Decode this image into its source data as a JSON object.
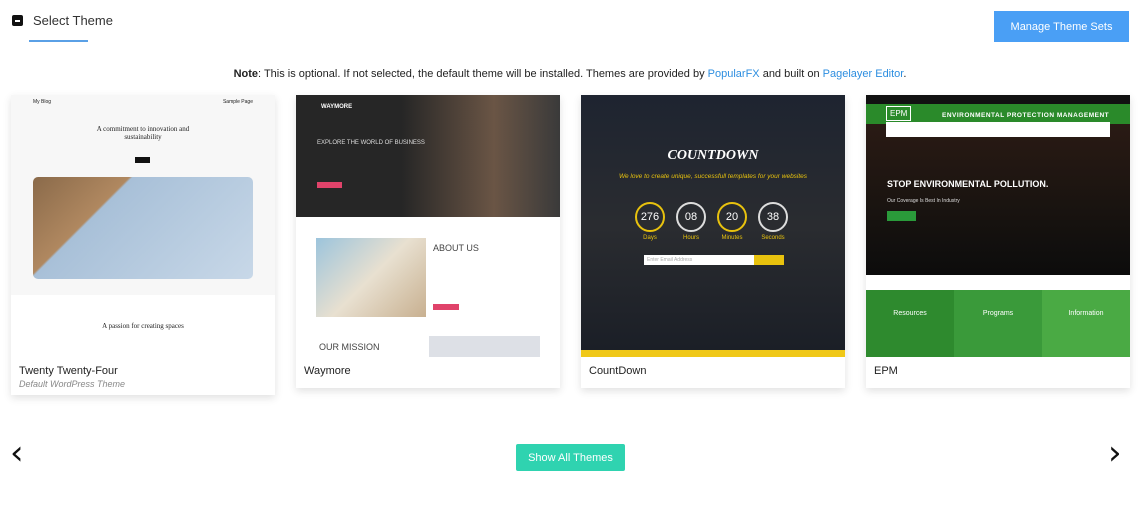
{
  "header": {
    "title": "Select Theme",
    "manage_button": "Manage Theme Sets"
  },
  "note": {
    "bold": "Note",
    "text": ": This is optional. If not selected, the default theme will be installed. Themes are provided by ",
    "link1": "PopularFX",
    "middle": " and built on ",
    "link2": "Pagelayer Editor",
    "end": "."
  },
  "themes": [
    {
      "name": "Twenty Twenty-Four",
      "subtitle": "Default WordPress Theme",
      "preview": {
        "site": "My Blog",
        "nav": "Sample Page",
        "headline": "A commitment to innovation and sustainability",
        "section": "A passion for creating spaces"
      }
    },
    {
      "name": "Waymore",
      "preview": {
        "logo": "WAYMORE",
        "hero": "EXPLORE THE WORLD OF BUSINESS",
        "about": "ABOUT US",
        "mission": "OUR MISSION"
      }
    },
    {
      "name": "CountDown",
      "preview": {
        "title": "COUNTDOWN",
        "tagline": "We love to create unique, successfull templates for your websites",
        "timer": [
          {
            "value": "276",
            "unit": "Days"
          },
          {
            "value": "08",
            "unit": "Hours"
          },
          {
            "value": "20",
            "unit": "Minutes"
          },
          {
            "value": "38",
            "unit": "Seconds"
          }
        ],
        "email_placeholder": "Enter Email Address"
      }
    },
    {
      "name": "EPM",
      "preview": {
        "logo": "EPM",
        "banner": "ENVIRONMENTAL PROTECTION MANAGEMENT",
        "hero": "STOP ENVIRONMENTAL POLLUTION.",
        "hero_sub": "Our Coverage Is Best In Industry",
        "columns": [
          "Resources",
          "Programs",
          "Information"
        ]
      }
    }
  ],
  "footer": {
    "show_all": "Show All Themes",
    "prev_icon": "chevron-left-icon",
    "next_icon": "chevron-right-icon"
  },
  "colors": {
    "accent": "#4a9ff5",
    "show_all": "#2fd3b0",
    "link": "#2d8ee0"
  }
}
